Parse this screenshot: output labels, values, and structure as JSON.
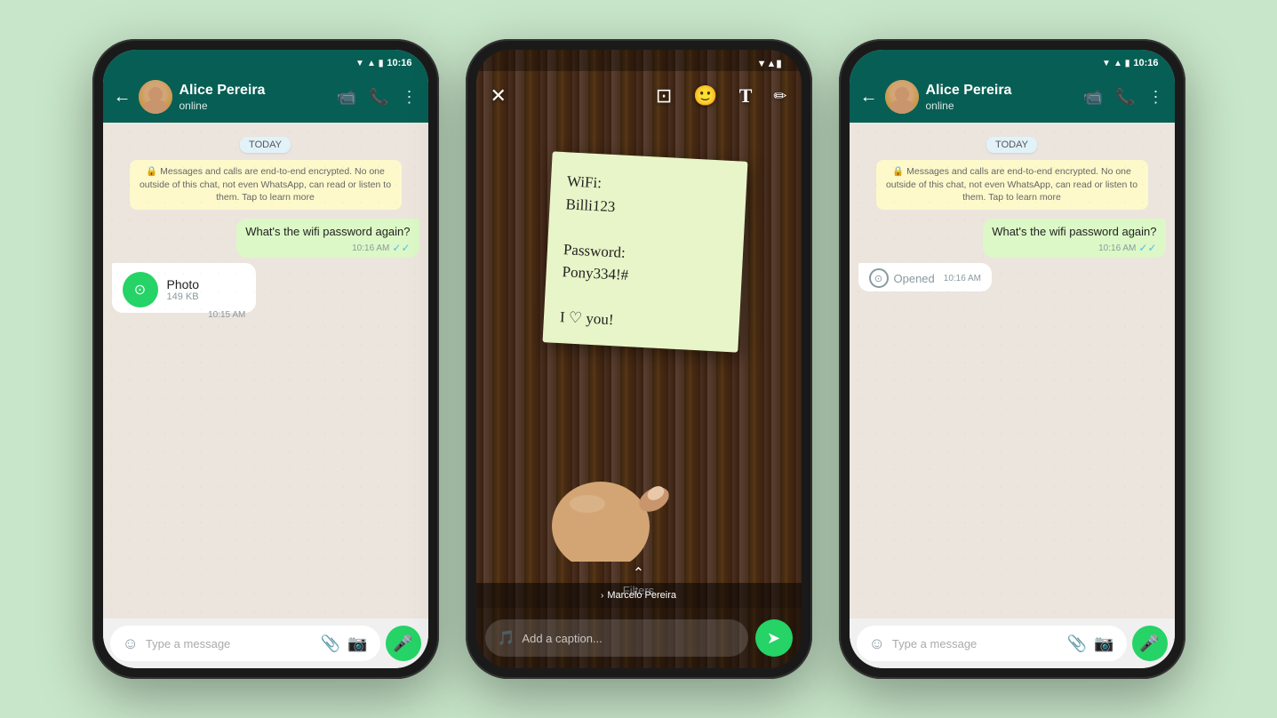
{
  "background_color": "#c8e6c9",
  "phone_left": {
    "status_bar": {
      "time": "10:16"
    },
    "header": {
      "contact_name": "Alice Pereira",
      "contact_status": "online",
      "back_label": "←",
      "video_icon": "📹",
      "call_icon": "📞",
      "menu_icon": "⋮"
    },
    "chat": {
      "date_badge": "TODAY",
      "system_message": "🔒 Messages and calls are end-to-end encrypted. No one outside of this chat, not even WhatsApp, can read or listen to them. Tap to learn more",
      "sent_message": {
        "text": "What's the wifi password again?",
        "time": "10:16 AM",
        "ticks": "✓✓"
      },
      "received_photo": {
        "label": "Photo",
        "size": "149 KB",
        "time": "10:15 AM",
        "icon": "①"
      }
    },
    "input_bar": {
      "placeholder": "Type a message",
      "mic_icon": "🎤"
    }
  },
  "phone_middle": {
    "status_bar": {
      "time": ""
    },
    "toolbar": {
      "close_icon": "✕",
      "crop_icon": "⊡",
      "emoji_icon": "🙂",
      "text_icon": "T",
      "pen_icon": "✏"
    },
    "sticky_note": {
      "text": "WiFi:\nBilli123\n\nPassword:\nPony334!#\n\nI ♡ you!"
    },
    "filters": {
      "chevron": "⌃",
      "label": "Filters"
    },
    "caption_bar": {
      "placeholder": "Add a caption...",
      "emoji_icon": "🎵",
      "send_icon": "➤"
    },
    "marcelo_bar": {
      "chevron": "›",
      "label": "Marcelo Pereira"
    }
  },
  "phone_right": {
    "status_bar": {
      "time": "10:16"
    },
    "header": {
      "contact_name": "Alice Pereira",
      "contact_status": "online",
      "back_label": "←",
      "video_icon": "📹",
      "call_icon": "📞",
      "menu_icon": "⋮"
    },
    "chat": {
      "date_badge": "TODAY",
      "system_message": "🔒 Messages and calls are end-to-end encrypted. No one outside of this chat, not even WhatsApp, can read or listen to them. Tap to learn more",
      "sent_message": {
        "text": "What's the wifi password again?",
        "time": "10:16 AM",
        "ticks": "✓✓"
      },
      "opened_message": {
        "label": "Opened",
        "time": "10:16 AM"
      }
    },
    "input_bar": {
      "placeholder": "Type a message",
      "mic_icon": "🎤"
    }
  }
}
